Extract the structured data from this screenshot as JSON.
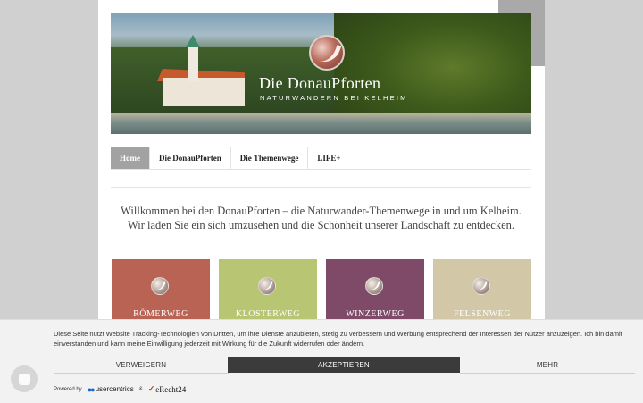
{
  "header": {
    "title": "Die DonauPforten",
    "subtitle": "NATURWANDERN BEI KELHEIM"
  },
  "nav": {
    "items": [
      {
        "label": "Home",
        "active": true
      },
      {
        "label": "Die DonauPforten",
        "active": false
      },
      {
        "label": "Die Themenwege",
        "active": false
      },
      {
        "label": "LIFE+",
        "active": false
      }
    ]
  },
  "welcome": {
    "line1": "Willkommen bei den DonauPforten – die Naturwander-Themenwege in und um Kelheim.",
    "line2": "Wir laden Sie ein sich umzusehen und die Schönheit unserer Landschaft zu entdecken."
  },
  "tiles": [
    {
      "label": "RÖMERWEG",
      "color": "#b96354"
    },
    {
      "label": "KLOSTERWEG",
      "color": "#b8c573"
    },
    {
      "label": "WINZERWEG",
      "color": "#7e4a68"
    },
    {
      "label": "FELSENWEG",
      "color": "#d2c7a6"
    }
  ],
  "cookie": {
    "text": "Diese Seite nutzt Website Tracking-Technologien von Dritten, um ihre Dienste anzubieten, stetig zu verbessern und Werbung entsprechend der Interessen der Nutzer anzuzeigen. Ich bin damit einverstanden und kann meine Einwilligung jederzeit mit Wirkung für die Zukunft widerrufen oder ändern.",
    "deny": "VERWEIGERN",
    "accept": "AKZEPTIEREN",
    "more": "MEHR",
    "powered_by": "Powered by",
    "usercentrics": "usercentrics",
    "amp": "&",
    "erecht": "eRecht24"
  }
}
